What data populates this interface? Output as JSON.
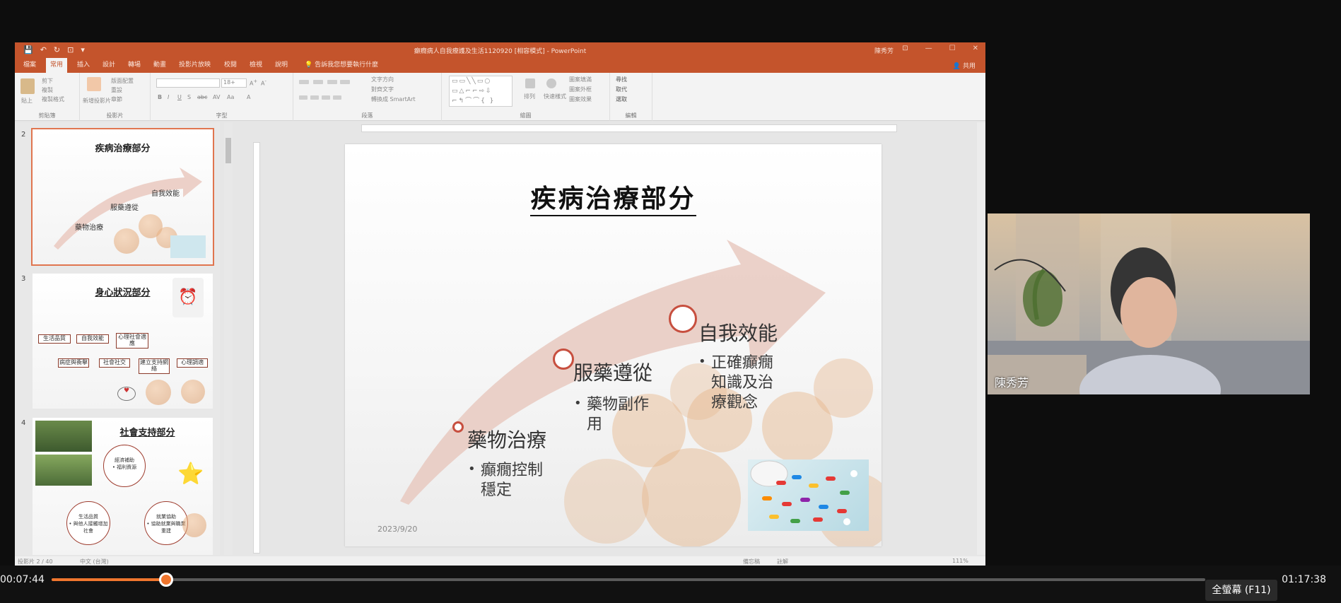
{
  "window": {
    "doc_title": "癲癇病人自我療護及生活1120920 [相容模式] - PowerPoint",
    "user": "陳秀芳",
    "qat": [
      "💾",
      "↶",
      "↻",
      "⊡",
      "▾"
    ],
    "winbtns": [
      "⊡",
      "—",
      "☐",
      "✕"
    ]
  },
  "tabs": [
    "檔案",
    "常用",
    "插入",
    "設計",
    "轉場",
    "動畫",
    "投影片放映",
    "校閱",
    "檢視",
    "說明"
  ],
  "active_tab": "常用",
  "tell_me": "告訴我您想要執行什麼",
  "share_label": "共用",
  "ribbon_groups": [
    "剪貼簿",
    "投影片",
    "字型",
    "段落",
    "繪圖",
    "編輯"
  ],
  "ribbon_labels": {
    "paste": "貼上",
    "cut": "剪下",
    "copy": "複製",
    "format_painter": "複製格式",
    "new_slide": "新增投影片",
    "layout": "版面配置",
    "reset": "重設",
    "section": "章節",
    "font_size": "18+",
    "text_direction": "文字方向",
    "align_text": "對齊文字",
    "smartart": "轉換成 SmartArt",
    "arrange": "排列",
    "quick_styles": "快速樣式",
    "shape_fill": "圖案填滿",
    "shape_outline": "圖案外框",
    "shape_effects": "圖案效果",
    "find": "尋找",
    "replace": "取代",
    "select": "選取"
  },
  "thumbnails": [
    {
      "num": "2",
      "title": "疾病治療部分",
      "selected": true
    },
    {
      "num": "3",
      "title": "身心狀況部分",
      "selected": false,
      "boxes_top": [
        "生活品質",
        "自我效能",
        "心理社會適應"
      ],
      "boxes_bottom": [
        "病症與衝擊",
        "社會社交",
        "建立支持網絡",
        "心理調適"
      ]
    },
    {
      "num": "4",
      "title": "社會支持部分",
      "selected": false,
      "circles": [
        {
          "label": "經濟補助",
          "sub": "• 福利資源"
        },
        {
          "label": "生活品質",
          "sub": "• 與他人接觸增加社會"
        },
        {
          "label": "就業協助",
          "sub": "• 協助就業與職業重建"
        }
      ]
    }
  ],
  "slide": {
    "title": "疾病治療部分",
    "date": "2023/9/20",
    "nodes": [
      {
        "label": "藥物治療",
        "bullet": "癲癇控制穩定"
      },
      {
        "label": "服藥遵從",
        "bullet": "藥物副作用"
      },
      {
        "label": "自我效能",
        "bullet": "正確癲癇知識及治療觀念"
      }
    ]
  },
  "statusbar": {
    "slide_info": "投影片 2 / 40",
    "language": "中文 (台灣)",
    "notes": "備忘稿",
    "comments": "註解",
    "zoom": "111%"
  },
  "webcam": {
    "name": "陳秀芳"
  },
  "player": {
    "current_time": "00:07:44",
    "total_time": "01:17:38",
    "progress": 0.0997,
    "fullscreen_label": "全螢幕 (F11)"
  },
  "colors": {
    "accent": "#c4542c",
    "progress": "#f0762e",
    "arrow": "#e8c9c0",
    "node_ring": "#c74f3f"
  }
}
